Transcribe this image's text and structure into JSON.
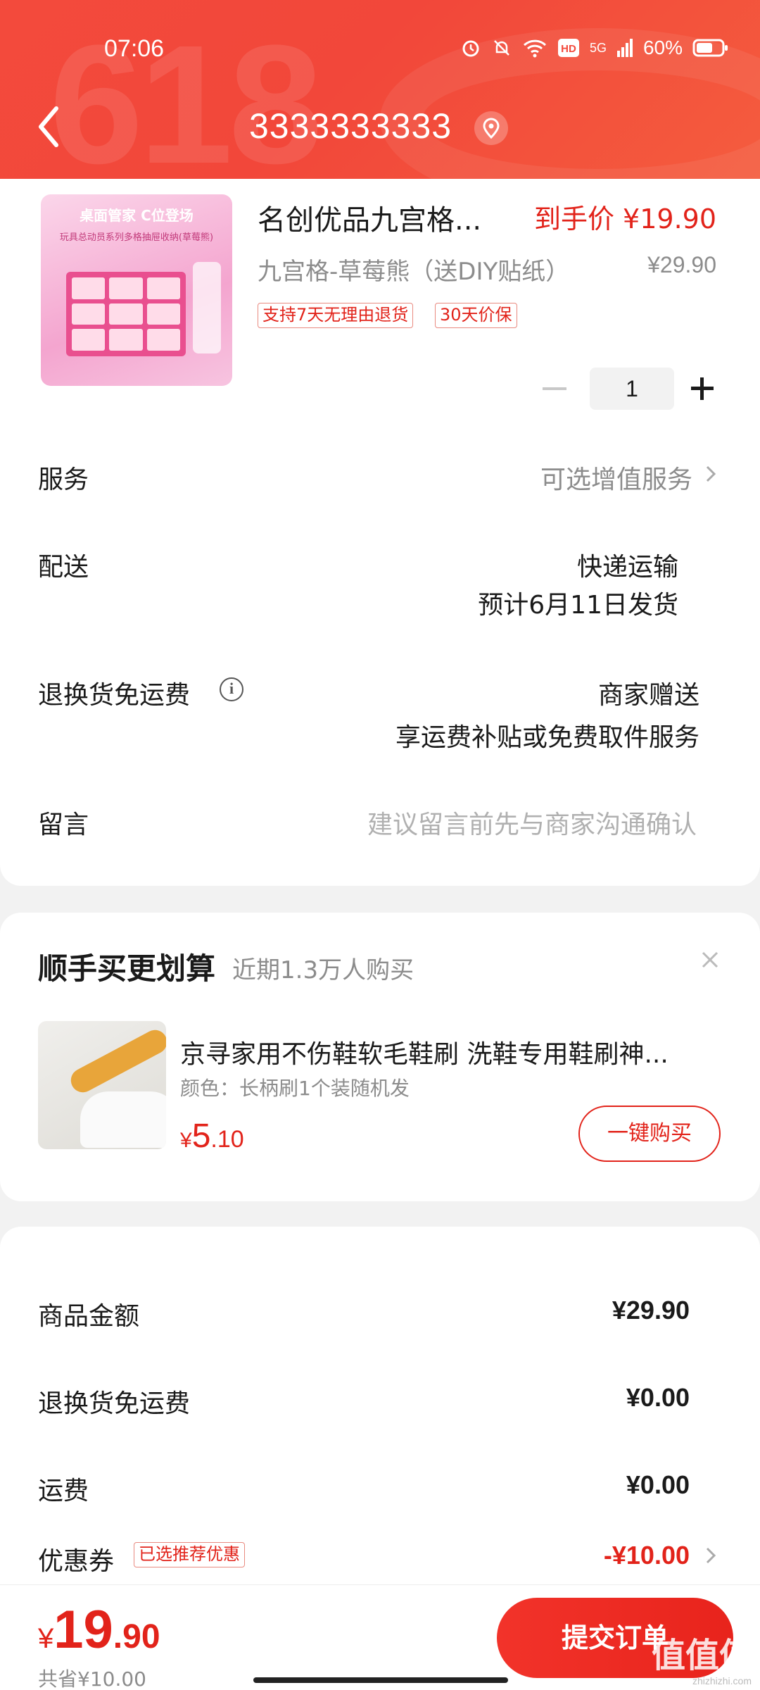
{
  "status_bar": {
    "time": "07:06",
    "network": "5G",
    "battery": "60%"
  },
  "nav": {
    "title": "3333333333"
  },
  "product": {
    "name": "名创优品九宫格...",
    "price_label": "到手价 ¥19.90",
    "spec": "九宫格-草莓熊（送DIY贴纸）",
    "original_price": "¥29.90",
    "tags": [
      "支持7天无理由退货",
      "30天价保"
    ],
    "quantity": "1",
    "image_banner": "桌面管家 C位登场",
    "image_subtext": "玩具总动员系列多格抽屉收纳(草莓熊)"
  },
  "rows": {
    "service_label": "服务",
    "service_value": "可选增值服务",
    "delivery_label": "配送",
    "delivery_method": "快递运输",
    "delivery_date": "预计6月11日发货",
    "return_label": "退换货免运费",
    "return_value": "商家赠送",
    "return_desc": "享运费补贴或免费取件服务",
    "message_label": "留言",
    "message_placeholder": "建议留言前先与商家沟通确认"
  },
  "addon": {
    "title": "顺手买更划算",
    "subtitle": "近期1.3万人购买",
    "item_name": "京寻家用不伤鞋软毛鞋刷 洗鞋专用鞋刷神...",
    "item_spec": "颜色：长柄刷1个装随机发",
    "price_currency": "¥",
    "price_int": "5",
    "price_dec": ".10",
    "buy_label": "一键购买"
  },
  "summary": {
    "goods_label": "商品金额",
    "goods_value": "¥29.90",
    "return_label": "退换货免运费",
    "return_value": "¥0.00",
    "freight_label": "运费",
    "freight_value": "¥0.00",
    "coupon_label": "优惠券",
    "coupon_tag": "已选推荐优惠",
    "coupon_value": "-¥10.00"
  },
  "footer": {
    "total_currency": "¥",
    "total_int": "19",
    "total_dec": ".90",
    "saved": "共省¥10.00",
    "submit_label": "提交订单",
    "watermark": "值值值",
    "watermark_sub": "zhizhizhi.com"
  },
  "colors": {
    "accent": "#e2231a",
    "header": "#f34a3c"
  }
}
